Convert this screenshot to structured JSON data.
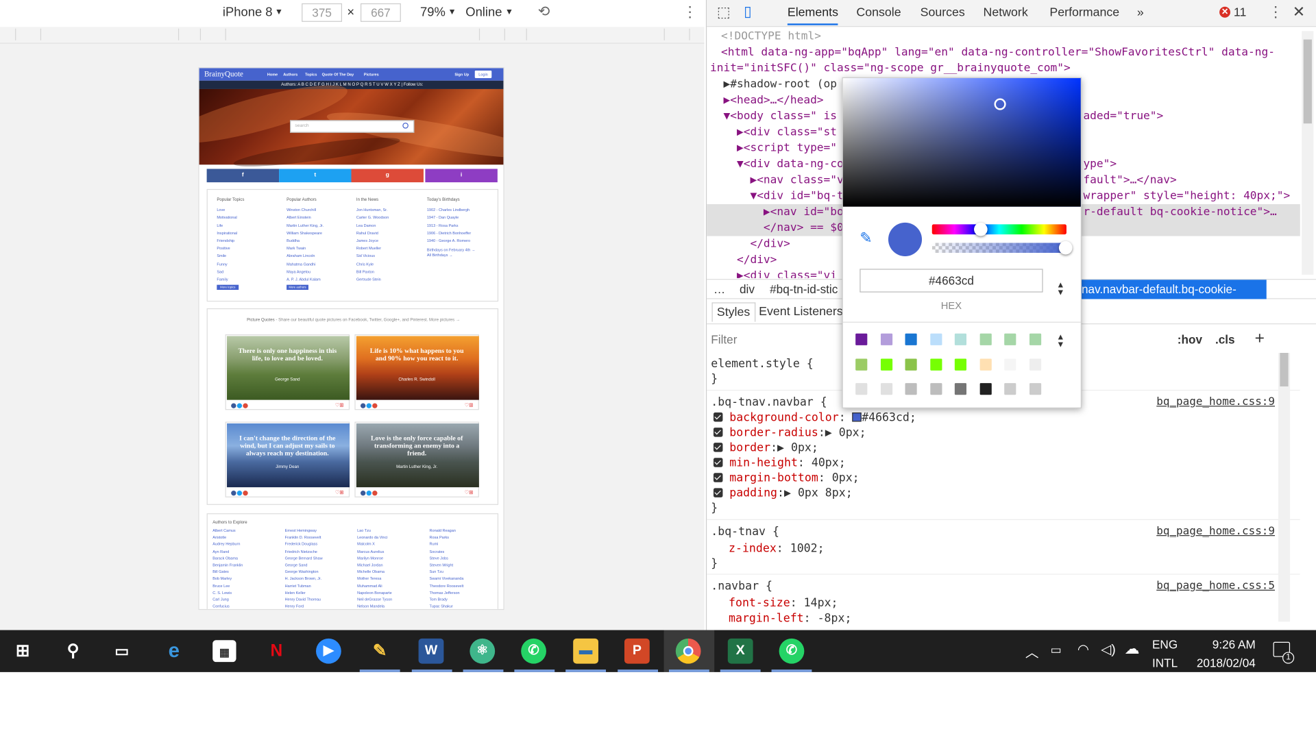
{
  "device": {
    "name": "iPhone 8",
    "width": "375",
    "height": "667",
    "zoom": "79%",
    "network": "Online",
    "times": "×"
  },
  "bq": {
    "logo": "BrainyQuote",
    "nav": [
      "Home",
      "Authors",
      "Topics",
      "Quote Of The Day",
      "Pictures"
    ],
    "signup": "Sign Up",
    "login": "Login",
    "authors_line": "Authors: A B C D E F G H I J K L M N O P Q R S T U V W X Y Z  |  Follow Us:",
    "search_placeholder": "search",
    "social": [
      "f",
      "t",
      "g",
      "i"
    ],
    "cols": [
      {
        "h": "Popular Topics",
        "items": [
          "Love",
          "Motivational",
          "Life",
          "Inspirational",
          "Friendship",
          "Positive",
          "Smile",
          "Funny",
          "Sad",
          "Family"
        ],
        "btn": "More topics"
      },
      {
        "h": "Popular Authors",
        "items": [
          "Winston Churchill",
          "Albert Einstein",
          "Martin Luther King, Jr.",
          "William Shakespeare",
          "Buddha",
          "Mark Twain",
          "Abraham Lincoln",
          "Mahatma Gandhi",
          "Maya Angelou",
          "A. P. J. Abdul Kalam"
        ],
        "btn": "More authors"
      },
      {
        "h": "In the News",
        "items": [
          "Jon Huntsman, Sr.",
          "Carter G. Woodson",
          "Lea Damon",
          "Rahul Dravid",
          "James Joyce",
          "Robert Mueller",
          "Sid Vicious",
          "Chris Kyle",
          "Bill Paxton",
          "Gertrude Stein"
        ],
        "btn": ""
      },
      {
        "h": "Today's Birthdays",
        "items": [
          "1902 - Charles Lindbergh",
          "1947 - Dan Quayle",
          "1913 - Rosa Parks",
          "1906 - Dietrich Bonhoeffer",
          "1940 - George A. Romero",
          "",
          "Birthdays on February 4th →",
          "All Birthdays →"
        ],
        "btn": ""
      }
    ],
    "pq_title": "Picture Quotes",
    "pq_sub": " - Share our beautiful quote pictures on Facebook, Twitter, Google+, and Pinterest. More pictures →",
    "pictures": [
      {
        "quote": "There is only one happiness in this life, to love and be loved.",
        "author": "George Sand"
      },
      {
        "quote": "Life is 10% what happens to you and 90% how you react to it.",
        "author": "Charles R. Swindoll"
      },
      {
        "quote": "I can't change the direction of the wind, but I can adjust my sails to always reach my destination.",
        "author": "Jimmy Dean"
      },
      {
        "quote": "Love is the only force capable of transforming an enemy into a friend.",
        "author": "Martin Luther King, Jr."
      }
    ],
    "explore_title": "Authors to Explore",
    "explore": [
      [
        "Albert Camus",
        "Aristotle",
        "Audrey Hepburn",
        "Ayn Rand",
        "Barack Obama",
        "Benjamin Franklin",
        "Bill Gates",
        "Bob Marley",
        "Bruce Lee",
        "C. S. Lewis",
        "Carl Jung",
        "Confucius"
      ],
      [
        "Ernest Hemingway",
        "Franklin D. Roosevelt",
        "Frederick Douglass",
        "Friedrich Nietzsche",
        "George Bernard Shaw",
        "George Sand",
        "George Washington",
        "H. Jackson Brown, Jr.",
        "Harriet Tubman",
        "Helen Keller",
        "Henry David Thoreau",
        "Henry Ford"
      ],
      [
        "Lao Tzu",
        "Leonardo da Vinci",
        "Malcolm X",
        "Marcus Aurelius",
        "Marilyn Monroe",
        "Michael Jordan",
        "Michelle Obama",
        "Mother Teresa",
        "Muhammad Ali",
        "Napoleon Bonaparte",
        "Neil deGrasse Tyson",
        "Nelson Mandela"
      ],
      [
        "Ronald Reagan",
        "Rosa Parks",
        "Rumi",
        "Socrates",
        "Steve Jobs",
        "Steven Wright",
        "Sun Tzu",
        "Swami Vivekananda",
        "Theodore Roosevelt",
        "Thomas Jefferson",
        "Tom Brady",
        "Tupac Shakur"
      ]
    ]
  },
  "devtools": {
    "tabs": [
      "Elements",
      "Console",
      "Sources",
      "Network",
      "Performance",
      "»"
    ],
    "errors": "11",
    "dom": [
      "<!DOCTYPE html>",
      "<html data-ng-app=\"bqApp\" lang=\"en\" data-ng-controller=\"ShowFavoritesCtrl\" data-ng-",
      "init=\"initSFC()\" class=\"ng-scope gr__brainyquote_com\">",
      "  ▶#shadow-root (op",
      "  ▶<head>…</head>",
      "  ▼<body class=\" is",
      "    ▶<div class=\"st",
      "    ▶<script type=\"",
      "    ▼<div data-ng-co",
      "      ▶<nav class=\"v",
      "      ▼<div id=\"bq-t",
      "        ▶<nav id=\"bo",
      "        </nav> == $0",
      "      </div>",
      "    </div>",
      "    ▶<div class=\"vi"
    ],
    "dom_right": [
      "aded=\"true\">",
      "ype\">",
      "fault\">…</nav>",
      "wrapper\" style=\"height: 40px;\">",
      "r-default bq-cookie-notice\">…"
    ],
    "crumbs": [
      "…",
      "div",
      "#bq-tn-id-stic"
    ],
    "crumb_selected": "nav.navbar-default.bq-cookie-notice",
    "style_tabs": [
      "Styles",
      "Event Listeners"
    ],
    "filter": "Filter",
    "hov": ":hov",
    "cls": ".cls",
    "plus": "+",
    "element_style": "element.style {",
    "rules": [
      {
        "sel": ".bq-tnav.navbar {",
        "src": "bq_page_home.css:9",
        "props": [
          {
            "n": "background-color",
            "v": "#4663cd;"
          },
          {
            "n": "border-radius",
            "v": "▶ 0px;"
          },
          {
            "n": "border",
            "v": "▶ 0px;"
          },
          {
            "n": "min-height",
            "v": "40px;"
          },
          {
            "n": "margin-bottom",
            "v": "0px;"
          },
          {
            "n": "padding",
            "v": "▶ 0px 8px;"
          }
        ]
      },
      {
        "sel": ".bq-tnav {",
        "src": "bq_page_home.css:9",
        "props": [
          {
            "n": "z-index",
            "v": "1002;"
          }
        ]
      },
      {
        "sel": ".navbar {",
        "src": "bq_page_home.css:5",
        "props": [
          {
            "n": "font-size",
            "v": "14px;"
          },
          {
            "n": "margin-left",
            "v": "-8px;"
          }
        ]
      }
    ],
    "picker": {
      "hex": "#4663cd",
      "label": "HEX",
      "swatches": [
        "#6a1b9a",
        "#b39ddb",
        "#1976d2",
        "#bbdefb",
        "#b2dfdb",
        "#a5d6a7",
        "#a5d6a7",
        "#a5d6a7",
        "#9ccc65",
        "#76ff03",
        "#8bc34a",
        "#76ff03",
        "#76ff03",
        "#ffe0b2",
        "#f5f5f5",
        "#eeeeee",
        "#e0e0e0",
        "#e0e0e0",
        "#bdbdbd",
        "#bdbdbd",
        "#757575",
        "#212121",
        "#cccccc",
        "#cccccc"
      ]
    }
  },
  "taskbar": {
    "lang1": "ENG",
    "lang2": "INTL",
    "time": "9:26 AM",
    "date": "2018/02/04",
    "notif": "1"
  }
}
